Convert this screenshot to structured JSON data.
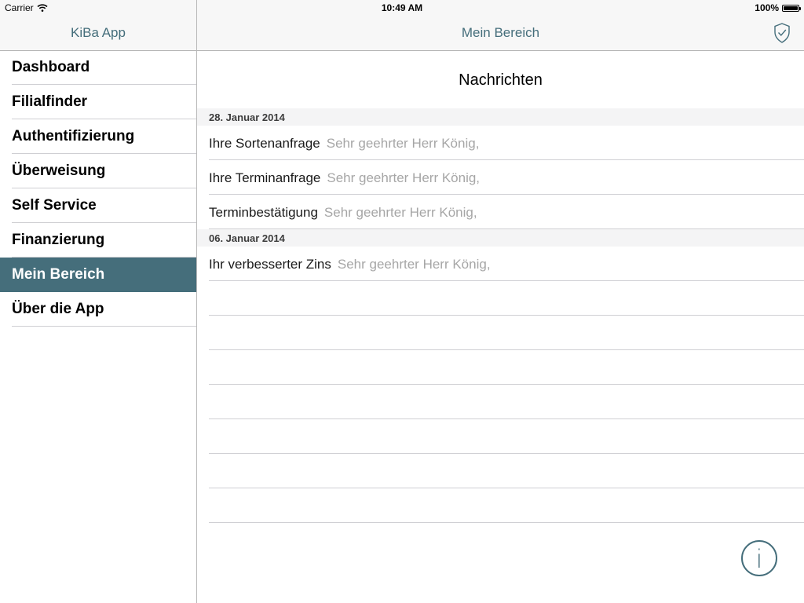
{
  "status_bar": {
    "carrier": "Carrier",
    "time": "10:49 AM",
    "battery": "100%"
  },
  "sidebar": {
    "title": "KiBa App",
    "items": [
      {
        "label": "Dashboard",
        "active": false
      },
      {
        "label": "Filialfinder",
        "active": false
      },
      {
        "label": "Authentifizierung",
        "active": false
      },
      {
        "label": "Überweisung",
        "active": false
      },
      {
        "label": "Self Service",
        "active": false
      },
      {
        "label": "Finanzierung",
        "active": false
      },
      {
        "label": "Mein Bereich",
        "active": true
      },
      {
        "label": "Über die App",
        "active": false
      }
    ]
  },
  "main": {
    "title": "Mein Bereich",
    "section_title": "Nachrichten",
    "groups": [
      {
        "date": "28. Januar 2014",
        "messages": [
          {
            "subject": "Ihre Sortenanfrage",
            "preview": "Sehr geehrter Herr König,"
          },
          {
            "subject": "Ihre Terminanfrage",
            "preview": "Sehr geehrter Herr König,"
          },
          {
            "subject": "Terminbestätigung",
            "preview": "Sehr geehrter Herr König,"
          }
        ]
      },
      {
        "date": "06. Januar 2014",
        "messages": [
          {
            "subject": "Ihr verbesserter Zins",
            "preview": "Sehr geehrter Herr König,"
          }
        ]
      }
    ],
    "info_button_label": "i"
  },
  "icons": {
    "nav_right": "shield-check-icon",
    "wifi": "wifi-icon",
    "battery": "battery-icon",
    "info": "info-icon"
  },
  "colors": {
    "accent": "#456e7b",
    "preview_text": "#a6a6a6",
    "group_header_bg": "#f4f4f5"
  }
}
